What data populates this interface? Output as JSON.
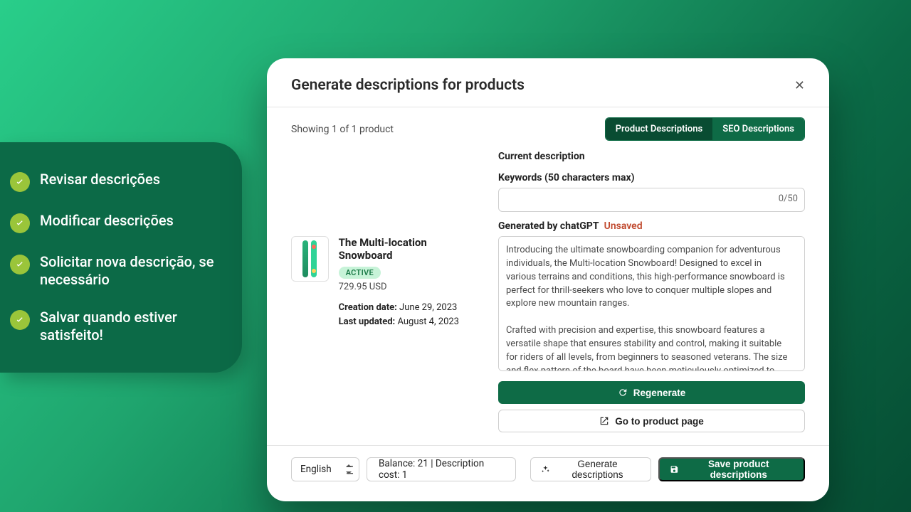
{
  "features": [
    "Revisar descrições",
    "Modificar descrições",
    "Solicitar nova descrição, se necessário",
    "Salvar quando estiver satisfeito!"
  ],
  "modal": {
    "title": "Generate descriptions for products",
    "showing": "Showing 1 of 1 product",
    "tabs": {
      "product": "Product Descriptions",
      "seo": "SEO Descriptions"
    },
    "product": {
      "title": "The Multi-location Snowboard",
      "badge": "ACTIVE",
      "price": "729.95 USD",
      "creation_label": "Creation date:",
      "creation_value": "June 29, 2023",
      "updated_label": "Last updated:",
      "updated_value": "August 4, 2023"
    },
    "right": {
      "current_label": "Current description",
      "keywords_label": "Keywords (50 characters max)",
      "keywords_value": "",
      "keywords_counter": "0/50",
      "generated_label": "Generated by chatGPT",
      "unsaved": "Unsaved",
      "generated_text": "Introducing the ultimate snowboarding companion for adventurous individuals, the Multi-location Snowboard! Designed to excel in various terrains and conditions, this high-performance snowboard is perfect for thrill-seekers who love to conquer multiple slopes and explore new mountain ranges.\n\nCrafted with precision and expertise, this snowboard features a versatile shape that ensures stability and control, making it suitable for riders of all levels, from beginners to seasoned veterans. The size and flex pattern of the board have been meticulously optimized to deliver optimal performance and maximize your riding experience.\n\nOne of the standout features of this snowboard is its innovative base technology.",
      "regenerate": "Regenerate",
      "goto": "Go to product page"
    },
    "footer": {
      "language": "English",
      "balance": "Balance: 21 | Description cost: 1",
      "generate": "Generate descriptions",
      "save": "Save product descriptions"
    }
  }
}
